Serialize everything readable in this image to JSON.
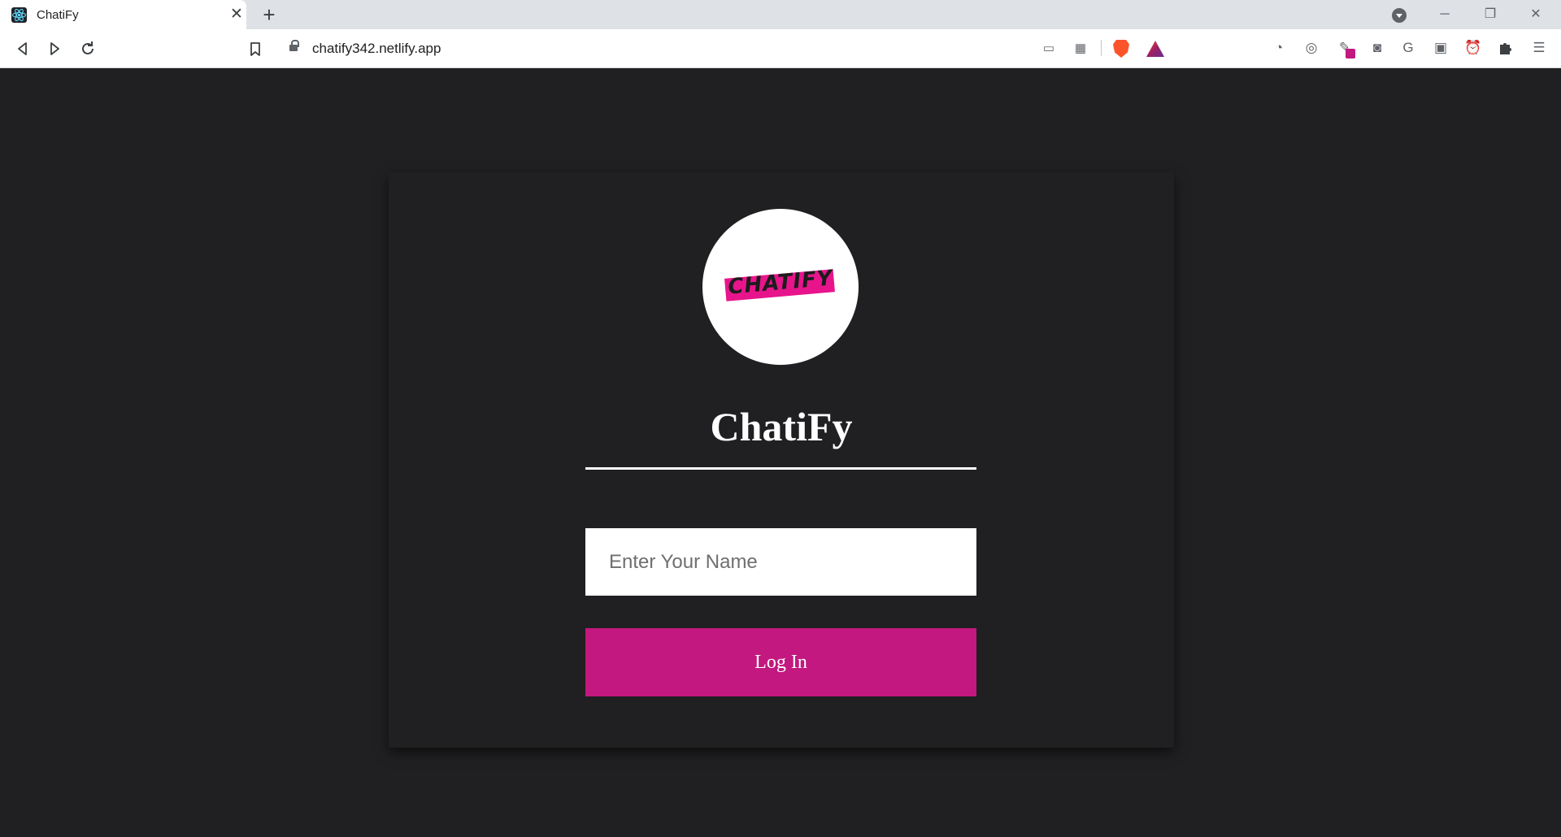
{
  "browser": {
    "tab_title": "ChatiFy",
    "tab_close": "✕",
    "new_tab": "+",
    "url": "chatify342.netlify.app",
    "window_buttons": [
      "─",
      "❐",
      "✕"
    ],
    "icons": {
      "back": "back-icon",
      "forward": "forward-icon",
      "reload": "reload-icon",
      "bookmark": "bookmark-icon",
      "lock": "lock-icon",
      "extensions": "puzzle-icon",
      "menu": "menu-icon"
    }
  },
  "app": {
    "logo_text": "CHATIFY",
    "title": "ChatiFy",
    "name_input": {
      "value": "",
      "placeholder": "Enter Your Name"
    },
    "login_label": "Log In",
    "colors": {
      "background": "#201f21",
      "accent": "#c2187f",
      "logo_band": "#e8148c"
    }
  }
}
